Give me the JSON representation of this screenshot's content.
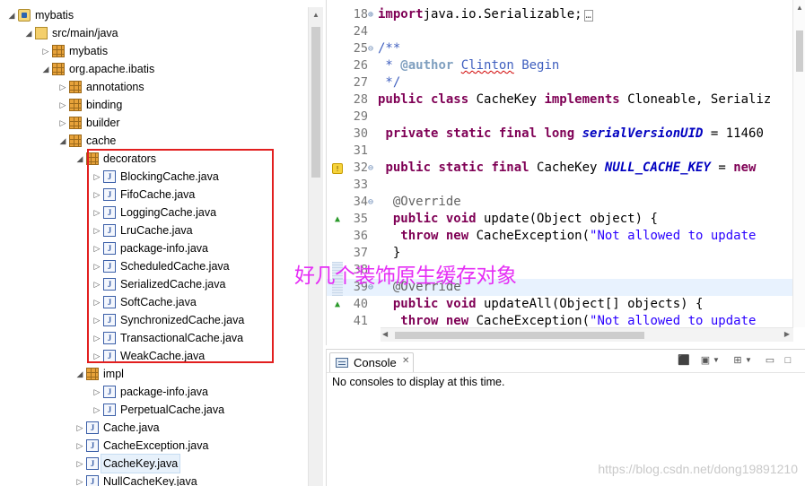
{
  "tree": {
    "items": [
      {
        "label": "mybatis",
        "level": 0,
        "toggle": "◢",
        "icon": "project"
      },
      {
        "label": "src/main/java",
        "level": 1,
        "toggle": "◢",
        "icon": "folder"
      },
      {
        "label": "mybatis",
        "level": 2,
        "toggle": "▷",
        "icon": "package"
      },
      {
        "label": "org.apache.ibatis",
        "level": 2,
        "toggle": "◢",
        "icon": "package"
      },
      {
        "label": "annotations",
        "level": 3,
        "toggle": "▷",
        "icon": "package"
      },
      {
        "label": "binding",
        "level": 3,
        "toggle": "▷",
        "icon": "package"
      },
      {
        "label": "builder",
        "level": 3,
        "toggle": "▷",
        "icon": "package"
      },
      {
        "label": "cache",
        "level": 3,
        "toggle": "◢",
        "icon": "package"
      },
      {
        "label": "decorators",
        "level": 4,
        "toggle": "◢",
        "icon": "package"
      },
      {
        "label": "BlockingCache.java",
        "level": 5,
        "toggle": "▷",
        "icon": "java"
      },
      {
        "label": "FifoCache.java",
        "level": 5,
        "toggle": "▷",
        "icon": "java"
      },
      {
        "label": "LoggingCache.java",
        "level": 5,
        "toggle": "▷",
        "icon": "java"
      },
      {
        "label": "LruCache.java",
        "level": 5,
        "toggle": "▷",
        "icon": "java"
      },
      {
        "label": "package-info.java",
        "level": 5,
        "toggle": "▷",
        "icon": "java"
      },
      {
        "label": "ScheduledCache.java",
        "level": 5,
        "toggle": "▷",
        "icon": "java"
      },
      {
        "label": "SerializedCache.java",
        "level": 5,
        "toggle": "▷",
        "icon": "java"
      },
      {
        "label": "SoftCache.java",
        "level": 5,
        "toggle": "▷",
        "icon": "java"
      },
      {
        "label": "SynchronizedCache.java",
        "level": 5,
        "toggle": "▷",
        "icon": "java"
      },
      {
        "label": "TransactionalCache.java",
        "level": 5,
        "toggle": "▷",
        "icon": "java"
      },
      {
        "label": "WeakCache.java",
        "level": 5,
        "toggle": "▷",
        "icon": "java"
      },
      {
        "label": "impl",
        "level": 4,
        "toggle": "◢",
        "icon": "package"
      },
      {
        "label": "package-info.java",
        "level": 5,
        "toggle": "▷",
        "icon": "java"
      },
      {
        "label": "PerpetualCache.java",
        "level": 5,
        "toggle": "▷",
        "icon": "java"
      },
      {
        "label": "Cache.java",
        "level": 4,
        "toggle": "▷",
        "icon": "java"
      },
      {
        "label": "CacheException.java",
        "level": 4,
        "toggle": "▷",
        "icon": "java"
      },
      {
        "label": "CacheKey.java",
        "level": 4,
        "toggle": "▷",
        "icon": "java",
        "selected": true
      },
      {
        "label": "NullCacheKey.java",
        "level": 4,
        "toggle": "▷",
        "icon": "java"
      }
    ]
  },
  "editor": {
    "lines": [
      {
        "n": "18",
        "fold": "⊕",
        "marker": "",
        "tokens": [
          [
            "kw",
            "import"
          ],
          [
            "",
            "java.io.Serializable;"
          ],
          [
            "box",
            "…"
          ]
        ]
      },
      {
        "n": "24",
        "fold": "",
        "marker": "",
        "tokens": []
      },
      {
        "n": "25",
        "fold": "⊖",
        "marker": "",
        "tokens": [
          [
            "cm",
            "/**"
          ]
        ]
      },
      {
        "n": "26",
        "fold": "",
        "marker": "",
        "tokens": [
          [
            "cm",
            " * "
          ],
          [
            "tag",
            "@author"
          ],
          [
            "cm",
            " "
          ],
          [
            "cmsq",
            "Clinton"
          ],
          [
            "cm",
            " Begin"
          ]
        ]
      },
      {
        "n": "27",
        "fold": "",
        "marker": "",
        "tokens": [
          [
            "cm",
            " */"
          ]
        ]
      },
      {
        "n": "28",
        "fold": "",
        "marker": "",
        "tokens": [
          [
            "kw",
            "public class"
          ],
          [
            "",
            " CacheKey "
          ],
          [
            "kw",
            "implements"
          ],
          [
            "",
            " Cloneable, Serializ"
          ]
        ]
      },
      {
        "n": "29",
        "fold": "",
        "marker": "",
        "tokens": []
      },
      {
        "n": "30",
        "fold": "",
        "marker": "",
        "tokens": [
          [
            "",
            " "
          ],
          [
            "kw",
            "private static final long"
          ],
          [
            "",
            " "
          ],
          [
            "sf",
            "serialVersionUID"
          ],
          [
            "",
            " = 11460"
          ]
        ]
      },
      {
        "n": "31",
        "fold": "",
        "marker": "",
        "tokens": []
      },
      {
        "n": "32",
        "fold": "⊖",
        "marker": "warn",
        "tokens": [
          [
            "",
            " "
          ],
          [
            "kw",
            "public static final"
          ],
          [
            "",
            " CacheKey "
          ],
          [
            "sf",
            "NULL_CACHE_KEY"
          ],
          [
            "",
            " = "
          ],
          [
            "kw",
            "new"
          ]
        ]
      },
      {
        "n": "33",
        "fold": "",
        "marker": "",
        "tokens": []
      },
      {
        "n": "34",
        "fold": "⊖",
        "marker": "",
        "tokens": [
          [
            "",
            "  "
          ],
          [
            "ann",
            "@Override"
          ]
        ]
      },
      {
        "n": "35",
        "fold": "",
        "marker": "up",
        "tokens": [
          [
            "",
            "  "
          ],
          [
            "kw",
            "public void"
          ],
          [
            "",
            " update(Object object) {"
          ]
        ]
      },
      {
        "n": "36",
        "fold": "",
        "marker": "",
        "tokens": [
          [
            "",
            "   "
          ],
          [
            "kw",
            "throw new"
          ],
          [
            "",
            " CacheException("
          ],
          [
            "str",
            "\"Not allowed to update"
          ]
        ]
      },
      {
        "n": "37",
        "fold": "",
        "marker": "",
        "tokens": [
          [
            "",
            "  }"
          ]
        ]
      },
      {
        "n": "38",
        "fold": "",
        "marker": "",
        "tokens": []
      },
      {
        "n": "39",
        "fold": "⊖",
        "marker": "",
        "current": true,
        "tokens": [
          [
            "",
            "  "
          ],
          [
            "ann",
            "@Override"
          ]
        ]
      },
      {
        "n": "40",
        "fold": "",
        "marker": "up",
        "tokens": [
          [
            "",
            "  "
          ],
          [
            "kw",
            "public void"
          ],
          [
            "",
            " updateAll(Object[] objects) {"
          ]
        ]
      },
      {
        "n": "41",
        "fold": "",
        "marker": "",
        "tokens": [
          [
            "",
            "   "
          ],
          [
            "kw",
            "throw new"
          ],
          [
            "",
            " CacheException("
          ],
          [
            "str",
            "\"Not allowed to update"
          ]
        ]
      }
    ]
  },
  "console": {
    "tab_label": "Console",
    "tab_close": "✕",
    "message": "No consoles to display at this time."
  },
  "overlay": {
    "caption": "好几个装饰原生缓存对象",
    "watermark": "https://blog.csdn.net/dong19891210"
  },
  "colors": {
    "highlight_box": "#e21f1f",
    "caption": "#e52ff5",
    "keyword": "#7f0055",
    "comment": "#3f5fbf",
    "string": "#2a00ff"
  }
}
